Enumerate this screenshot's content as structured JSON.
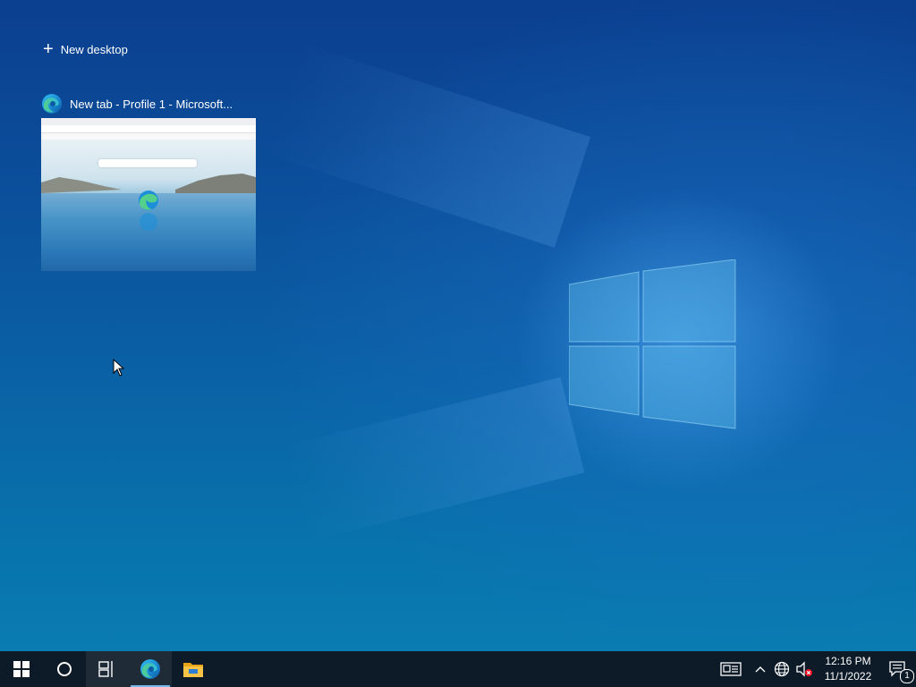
{
  "task_view": {
    "new_desktop_label": "New desktop",
    "window": {
      "title": "New tab - Profile 1 - Microsoft...",
      "app_icon": "edge-icon"
    }
  },
  "taskbar": {
    "start_icon": "windows-start-icon",
    "search_icon": "cortana-circle-icon",
    "task_view_icon": "task-view-icon",
    "pinned": [
      {
        "name": "edge-icon",
        "active": true
      },
      {
        "name": "file-explorer-icon",
        "active": false
      }
    ],
    "tray": {
      "news_icon": "news-and-interests-icon",
      "overflow_icon": "chevron-up-icon",
      "network_icon": "network-globe-icon",
      "volume_icon": "volume-muted-icon",
      "time": "12:16 PM",
      "date": "11/1/2022",
      "notification_count": "1"
    }
  },
  "colors": {
    "taskbar_bg": "#0d1a27",
    "desktop_top": "#0b3f8f",
    "desktop_bottom": "#0a7cb1",
    "active_underline": "#76b9ed"
  }
}
